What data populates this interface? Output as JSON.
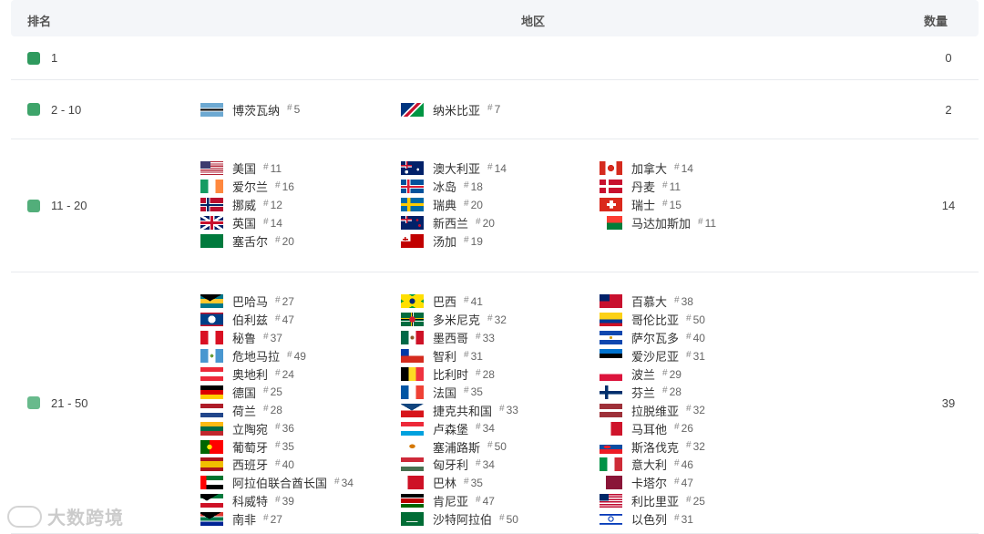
{
  "header": {
    "rank": "排名",
    "region": "地区",
    "count": "数量"
  },
  "rows": [
    {
      "rank": "1",
      "count": "0",
      "color": "#2f9a5e",
      "columns": [
        [],
        [],
        []
      ]
    },
    {
      "rank": "2 - 10",
      "count": "2",
      "color": "#3ea46a",
      "columns": [
        [
          {
            "name": "博茨瓦纳",
            "num": "5",
            "flag": "botswana"
          }
        ],
        [
          {
            "name": "纳米比亚",
            "num": "7",
            "flag": "namibia"
          }
        ],
        []
      ]
    },
    {
      "rank": "11 - 20",
      "count": "14",
      "color": "#52ae7a",
      "columns": [
        [
          {
            "name": "美国",
            "num": "11",
            "flag": "usa"
          },
          {
            "name": "爱尔兰",
            "num": "16",
            "flag": "ireland"
          },
          {
            "name": "挪威",
            "num": "12",
            "flag": "norway"
          },
          {
            "name": "英国",
            "num": "14",
            "flag": "uk"
          },
          {
            "name": "塞舌尔",
            "num": "20",
            "flag": "seychelles"
          }
        ],
        [
          {
            "name": "澳大利亚",
            "num": "14",
            "flag": "australia"
          },
          {
            "name": "冰岛",
            "num": "18",
            "flag": "iceland"
          },
          {
            "name": "瑞典",
            "num": "20",
            "flag": "sweden"
          },
          {
            "name": "新西兰",
            "num": "20",
            "flag": "newzealand"
          },
          {
            "name": "汤加",
            "num": "19",
            "flag": "tonga"
          }
        ],
        [
          {
            "name": "加拿大",
            "num": "14",
            "flag": "canada"
          },
          {
            "name": "丹麦",
            "num": "11",
            "flag": "denmark"
          },
          {
            "name": "瑞士",
            "num": "15",
            "flag": "switzerland"
          },
          {
            "name": "马达加斯加",
            "num": "11",
            "flag": "madagascar"
          }
        ]
      ]
    },
    {
      "rank": "21 - 50",
      "count": "39",
      "color": "#68ba8c",
      "columns": [
        [
          {
            "name": "巴哈马",
            "num": "27",
            "flag": "bahamas"
          },
          {
            "name": "伯利兹",
            "num": "47",
            "flag": "belize"
          },
          {
            "name": "秘鲁",
            "num": "37",
            "flag": "peru"
          },
          {
            "name": "危地马拉",
            "num": "49",
            "flag": "guatemala"
          },
          {
            "name": "奥地利",
            "num": "24",
            "flag": "austria"
          },
          {
            "name": "德国",
            "num": "25",
            "flag": "germany"
          },
          {
            "name": "荷兰",
            "num": "28",
            "flag": "netherlands"
          },
          {
            "name": "立陶宛",
            "num": "36",
            "flag": "lithuania"
          },
          {
            "name": "葡萄牙",
            "num": "35",
            "flag": "portugal"
          },
          {
            "name": "西班牙",
            "num": "40",
            "flag": "spain"
          },
          {
            "name": "阿拉伯联合酋长国",
            "num": "34",
            "flag": "uae"
          },
          {
            "name": "科威特",
            "num": "39",
            "flag": "kuwait"
          },
          {
            "name": "南非",
            "num": "27",
            "flag": "southafrica"
          }
        ],
        [
          {
            "name": "巴西",
            "num": "41",
            "flag": "brazil"
          },
          {
            "name": "多米尼克",
            "num": "32",
            "flag": "dominica"
          },
          {
            "name": "墨西哥",
            "num": "33",
            "flag": "mexico"
          },
          {
            "name": "智利",
            "num": "31",
            "flag": "chile"
          },
          {
            "name": "比利时",
            "num": "28",
            "flag": "belgium"
          },
          {
            "name": "法国",
            "num": "35",
            "flag": "france"
          },
          {
            "name": "捷克共和国",
            "num": "33",
            "flag": "czech"
          },
          {
            "name": "卢森堡",
            "num": "34",
            "flag": "luxembourg"
          },
          {
            "name": "塞浦路斯",
            "num": "50",
            "flag": "cyprus"
          },
          {
            "name": "匈牙利",
            "num": "34",
            "flag": "hungary"
          },
          {
            "name": "巴林",
            "num": "35",
            "flag": "bahrain"
          },
          {
            "name": "肯尼亚",
            "num": "47",
            "flag": "kenya"
          },
          {
            "name": "沙特阿拉伯",
            "num": "50",
            "flag": "saudi"
          }
        ],
        [
          {
            "name": "百慕大",
            "num": "38",
            "flag": "bermuda"
          },
          {
            "name": "哥伦比亚",
            "num": "50",
            "flag": "colombia"
          },
          {
            "name": "萨尔瓦多",
            "num": "40",
            "flag": "elsalvador"
          },
          {
            "name": "爱沙尼亚",
            "num": "31",
            "flag": "estonia"
          },
          {
            "name": "波兰",
            "num": "29",
            "flag": "poland"
          },
          {
            "name": "芬兰",
            "num": "28",
            "flag": "finland"
          },
          {
            "name": "拉脱维亚",
            "num": "32",
            "flag": "latvia"
          },
          {
            "name": "马耳他",
            "num": "26",
            "flag": "malta"
          },
          {
            "name": "斯洛伐克",
            "num": "32",
            "flag": "slovakia"
          },
          {
            "name": "意大利",
            "num": "46",
            "flag": "italy"
          },
          {
            "name": "卡塔尔",
            "num": "47",
            "flag": "qatar"
          },
          {
            "name": "利比里亚",
            "num": "25",
            "flag": "liberia"
          },
          {
            "name": "以色列",
            "num": "31",
            "flag": "israel"
          }
        ]
      ]
    }
  ],
  "watermark": "大数跨境"
}
